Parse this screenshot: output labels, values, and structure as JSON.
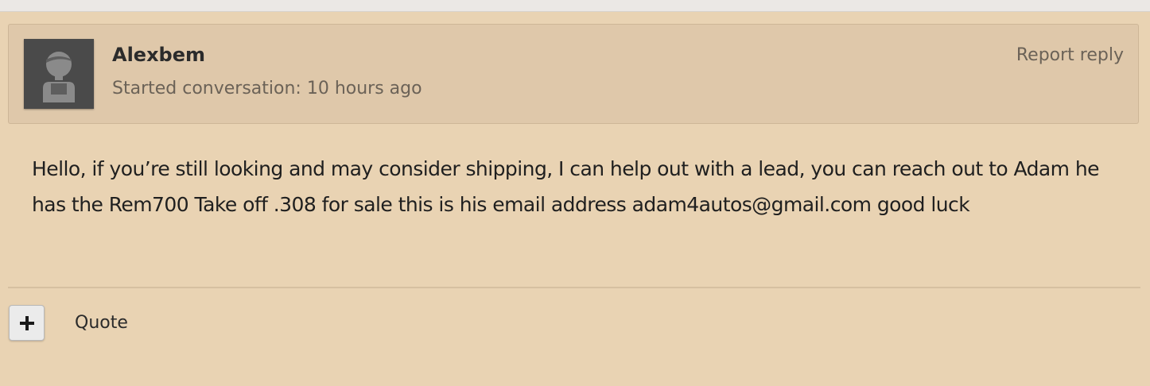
{
  "post": {
    "author": "Alexbem",
    "started": "Started conversation: 10 hours ago",
    "report_label": "Report reply",
    "body": "Hello, if you’re still looking and may consider shipping, I can help out with a lead, you can reach out to Adam he has the Rem700 Take off .308 for sale this is his email address adam4autos@gmail.com good luck"
  },
  "actions": {
    "expand_icon": "plus-icon",
    "quote_label": "Quote"
  },
  "icons": {
    "avatar": "default-user-avatar-icon"
  },
  "colors": {
    "background": "#e9d3b3",
    "header_background": "#dfc8aa",
    "muted_text": "#6b6257",
    "avatar_background": "#4a4a4a"
  }
}
